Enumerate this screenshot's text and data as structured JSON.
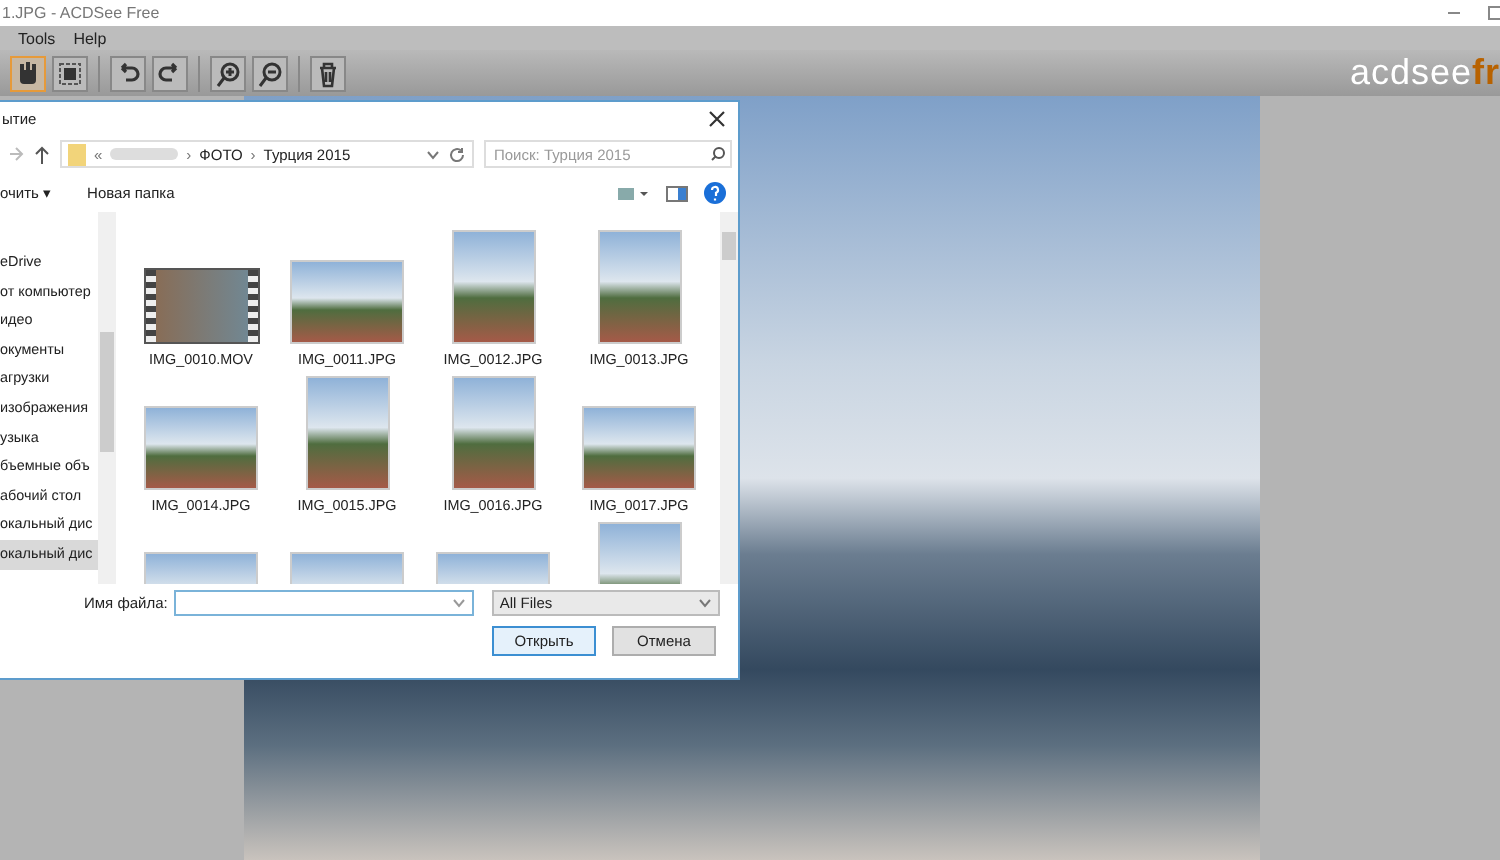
{
  "app": {
    "title": "1.JPG - ACDSee Free",
    "menu": [
      "Tools",
      "Help"
    ],
    "toolbar": [
      {
        "kind": "hand",
        "selected": true
      },
      {
        "kind": "select",
        "selected": false
      },
      {
        "kind": "undo",
        "selected": false
      },
      {
        "kind": "redo",
        "selected": false
      },
      {
        "kind": "zoom-in",
        "selected": false
      },
      {
        "kind": "zoom-out",
        "selected": false
      },
      {
        "kind": "delete",
        "selected": false
      }
    ],
    "logo": {
      "main": "acdsee",
      "accent": "fr"
    }
  },
  "dialog": {
    "title": "ытие",
    "overflow_mark": "«",
    "separator": "›",
    "path": [
      "ФОТО",
      "Турция 2015"
    ],
    "search": {
      "placeholder": "Поиск: Турция 2015"
    },
    "commands": {
      "organize": "очить ▾",
      "new_folder": "Новая папка"
    },
    "sidebar": [
      {
        "label": "eDrive",
        "selected": false
      },
      {
        "label": "от компьютер",
        "selected": false
      },
      {
        "label": "идео",
        "selected": false
      },
      {
        "label": "окументы",
        "selected": false
      },
      {
        "label": "агрузки",
        "selected": false
      },
      {
        "label": "изображения",
        "selected": false
      },
      {
        "label": "узыка",
        "selected": false
      },
      {
        "label": "бъемные объ",
        "selected": false
      },
      {
        "label": "абочий стол",
        "selected": false
      },
      {
        "label": "окальный дис",
        "selected": false
      },
      {
        "label": "окальный дис",
        "selected": true
      }
    ],
    "files": [
      {
        "name": "IMG_0010.MOV",
        "kind": "video",
        "portrait": false
      },
      {
        "name": "IMG_0011.JPG",
        "kind": "photo",
        "portrait": false
      },
      {
        "name": "IMG_0012.JPG",
        "kind": "photo",
        "portrait": true
      },
      {
        "name": "IMG_0013.JPG",
        "kind": "photo",
        "portrait": true
      },
      {
        "name": "IMG_0014.JPG",
        "kind": "photo",
        "portrait": false
      },
      {
        "name": "IMG_0015.JPG",
        "kind": "photo",
        "portrait": true
      },
      {
        "name": "IMG_0016.JPG",
        "kind": "photo",
        "portrait": true
      },
      {
        "name": "IMG_0017.JPG",
        "kind": "photo",
        "portrait": false
      },
      {
        "kind": "photo",
        "portrait": false
      },
      {
        "kind": "photo",
        "portrait": false
      },
      {
        "kind": "photo",
        "portrait": false
      },
      {
        "kind": "photo",
        "portrait": true
      }
    ],
    "filename_label": "Имя файла:",
    "filetype": "All Files",
    "buttons": [
      {
        "label": "Открыть",
        "focused": true
      },
      {
        "label": "Отмена",
        "focused": false
      }
    ]
  }
}
